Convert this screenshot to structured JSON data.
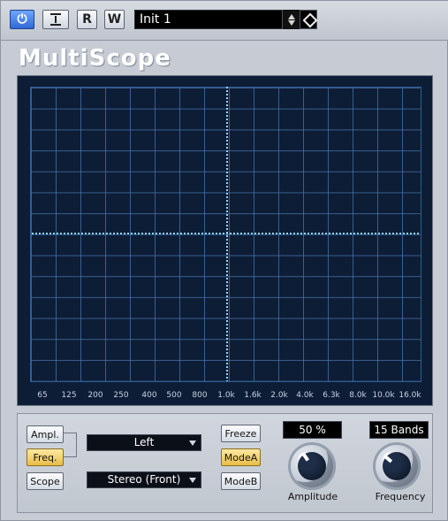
{
  "toolbar": {
    "power_icon": "power-icon",
    "bypass_icon": "bypass-icon",
    "read_label": "R",
    "write_label": "W",
    "preset_name": "Init 1"
  },
  "plugin": {
    "title": "MultiScope"
  },
  "scope": {
    "frequency_labels": [
      "65",
      "125",
      "200",
      "250",
      "400",
      "500",
      "800",
      "1.0k",
      "1.6k",
      "2.0k",
      "4.0k",
      "6.3k",
      "8.0k",
      "10.0k",
      "16.0k"
    ]
  },
  "controls": {
    "ampl_label": "Ampl.",
    "freq_label": "Freq.",
    "scope_label": "Scope",
    "channel_value": "Left",
    "stereo_value": "Stereo (Front)",
    "freeze_label": "Freeze",
    "mode_a_label": "ModeA",
    "mode_b_label": "ModeB",
    "amplitude_value": "50 %",
    "amplitude_label": "Amplitude",
    "bands_value": "15 Bands",
    "frequency_label": "Frequency"
  },
  "colors": {
    "scope_background": "#0d1d36",
    "grid": "#4874aa",
    "trace": "#8fd7ff",
    "active_button": "#e7bd46"
  }
}
